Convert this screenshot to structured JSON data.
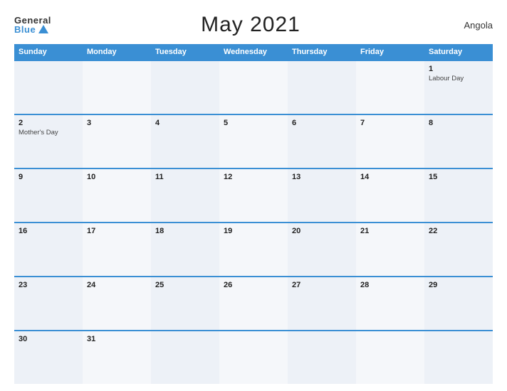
{
  "header": {
    "logo_general": "General",
    "logo_blue": "Blue",
    "month_title": "May 2021",
    "country": "Angola"
  },
  "calendar": {
    "days_of_week": [
      "Sunday",
      "Monday",
      "Tuesday",
      "Wednesday",
      "Thursday",
      "Friday",
      "Saturday"
    ],
    "weeks": [
      [
        {
          "day": "",
          "event": ""
        },
        {
          "day": "",
          "event": ""
        },
        {
          "day": "",
          "event": ""
        },
        {
          "day": "",
          "event": ""
        },
        {
          "day": "",
          "event": ""
        },
        {
          "day": "",
          "event": ""
        },
        {
          "day": "1",
          "event": "Labour Day"
        }
      ],
      [
        {
          "day": "2",
          "event": "Mother's Day"
        },
        {
          "day": "3",
          "event": ""
        },
        {
          "day": "4",
          "event": ""
        },
        {
          "day": "5",
          "event": ""
        },
        {
          "day": "6",
          "event": ""
        },
        {
          "day": "7",
          "event": ""
        },
        {
          "day": "8",
          "event": ""
        }
      ],
      [
        {
          "day": "9",
          "event": ""
        },
        {
          "day": "10",
          "event": ""
        },
        {
          "day": "11",
          "event": ""
        },
        {
          "day": "12",
          "event": ""
        },
        {
          "day": "13",
          "event": ""
        },
        {
          "day": "14",
          "event": ""
        },
        {
          "day": "15",
          "event": ""
        }
      ],
      [
        {
          "day": "16",
          "event": ""
        },
        {
          "day": "17",
          "event": ""
        },
        {
          "day": "18",
          "event": ""
        },
        {
          "day": "19",
          "event": ""
        },
        {
          "day": "20",
          "event": ""
        },
        {
          "day": "21",
          "event": ""
        },
        {
          "day": "22",
          "event": ""
        }
      ],
      [
        {
          "day": "23",
          "event": ""
        },
        {
          "day": "24",
          "event": ""
        },
        {
          "day": "25",
          "event": ""
        },
        {
          "day": "26",
          "event": ""
        },
        {
          "day": "27",
          "event": ""
        },
        {
          "day": "28",
          "event": ""
        },
        {
          "day": "29",
          "event": ""
        }
      ],
      [
        {
          "day": "30",
          "event": ""
        },
        {
          "day": "31",
          "event": ""
        },
        {
          "day": "",
          "event": ""
        },
        {
          "day": "",
          "event": ""
        },
        {
          "day": "",
          "event": ""
        },
        {
          "day": "",
          "event": ""
        },
        {
          "day": "",
          "event": ""
        }
      ]
    ]
  }
}
